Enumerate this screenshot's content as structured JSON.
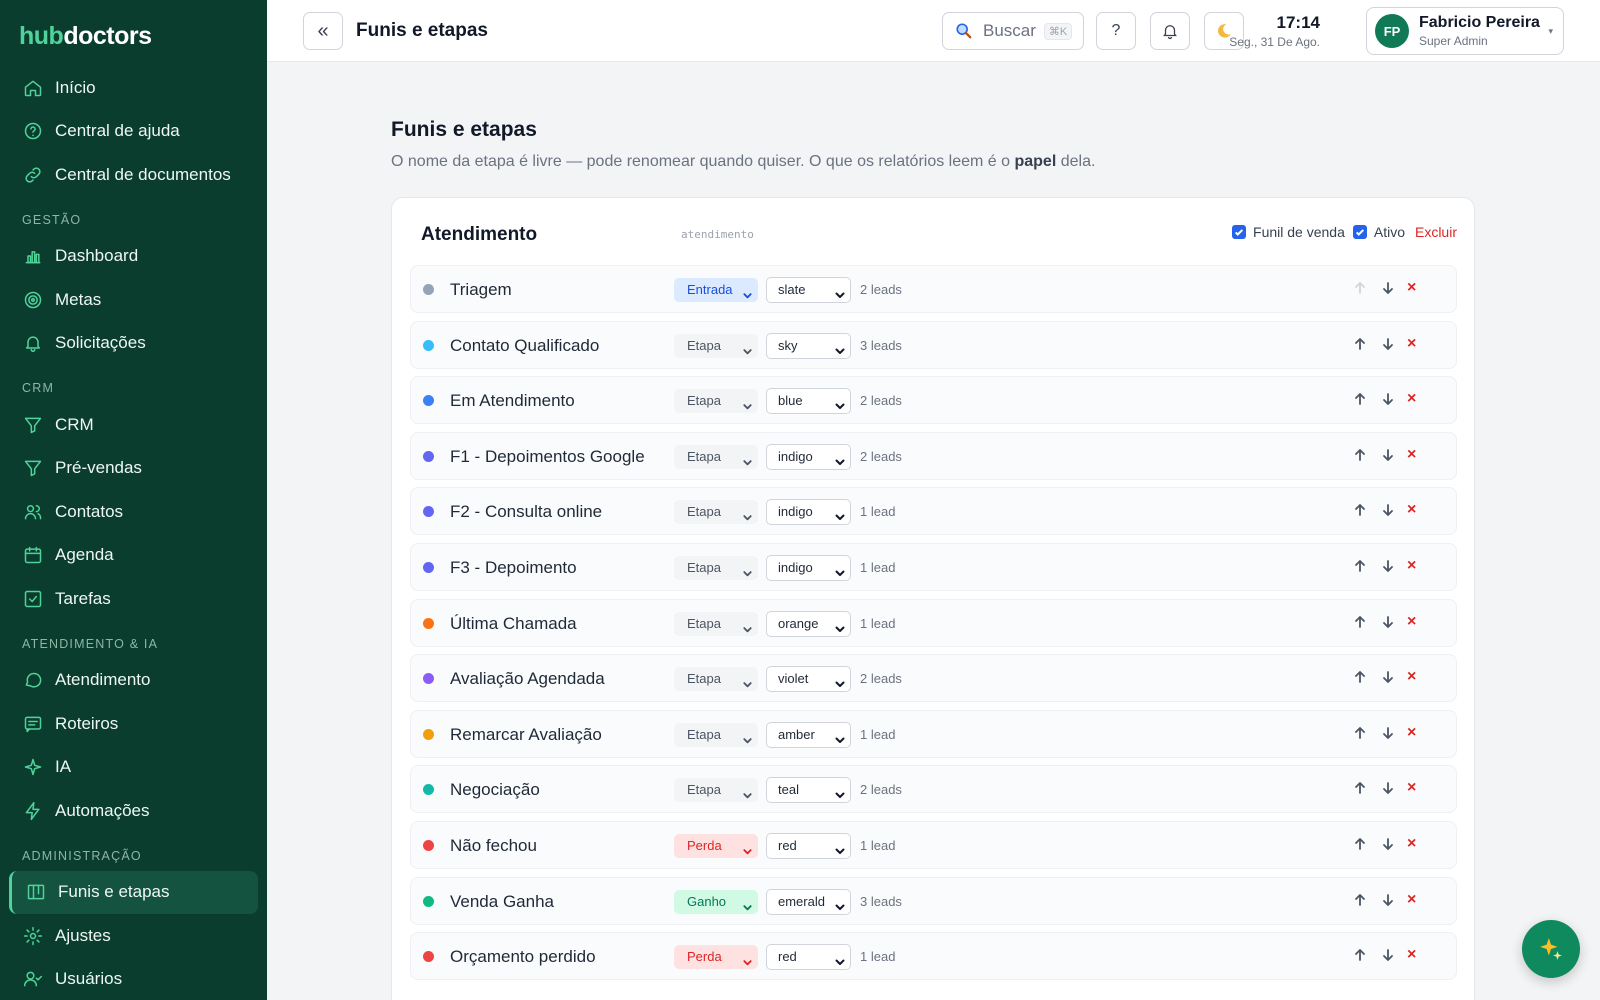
{
  "brand": {
    "part1": "hub",
    "part2": "doctors"
  },
  "sidebar": {
    "top_items": [
      {
        "label": "Início",
        "icon": "home-icon"
      },
      {
        "label": "Central de ajuda",
        "icon": "help-circle-icon"
      },
      {
        "label": "Central de documentos",
        "icon": "link-icon"
      }
    ],
    "sections": [
      {
        "title": "GESTÃO",
        "items": [
          {
            "label": "Dashboard",
            "icon": "bar-chart-icon"
          },
          {
            "label": "Metas",
            "icon": "target-icon"
          },
          {
            "label": "Solicitações",
            "icon": "bell-icon"
          }
        ]
      },
      {
        "title": "CRM",
        "items": [
          {
            "label": "CRM",
            "icon": "filter-icon"
          },
          {
            "label": "Pré-vendas",
            "icon": "filter-icon"
          },
          {
            "label": "Contatos",
            "icon": "users-icon"
          },
          {
            "label": "Agenda",
            "icon": "calendar-icon"
          },
          {
            "label": "Tarefas",
            "icon": "checkbox-icon"
          }
        ]
      },
      {
        "title": "ATENDIMENTO & IA",
        "items": [
          {
            "label": "Atendimento",
            "icon": "chat-icon"
          },
          {
            "label": "Roteiros",
            "icon": "message-square-icon"
          },
          {
            "label": "IA",
            "icon": "sparkle-icon"
          },
          {
            "label": "Automações",
            "icon": "bolt-icon"
          }
        ]
      },
      {
        "title": "ADMINISTRAÇÃO",
        "items": [
          {
            "label": "Funis e etapas",
            "icon": "kanban-icon",
            "active": true
          },
          {
            "label": "Ajustes",
            "icon": "gear-icon"
          },
          {
            "label": "Usuários",
            "icon": "user-check-icon"
          }
        ]
      }
    ]
  },
  "topbar": {
    "collapse_label": "«",
    "title": "Funis e etapas",
    "search_label": "Buscar",
    "search_shortcut": "⌘K",
    "help_label": "?",
    "time": "17:14",
    "date": "Seg., 31 De Ago.",
    "user_initials": "FP",
    "user_name": "Fabricio Pereira",
    "user_role": "Super Admin"
  },
  "main": {
    "title": "Funis e etapas",
    "subtitle_pre": "O nome da etapa é livre — pode renomear quando quiser. O que os relatórios leem é o ",
    "subtitle_bold": "papel",
    "subtitle_post": " dela."
  },
  "funnel": {
    "name": "Atendimento",
    "slug": "atendimento",
    "sales_funnel_label": "Funil de venda",
    "active_label": "Ativo",
    "delete_label": "Excluir",
    "stages": [
      {
        "name": "Triagem",
        "role": "Entrada",
        "color": "slate",
        "leads": "2 leads",
        "dot": "#94a3b8"
      },
      {
        "name": "Contato Qualificado",
        "role": "Etapa",
        "color": "sky",
        "leads": "3 leads",
        "dot": "#38bdf8"
      },
      {
        "name": "Em Atendimento",
        "role": "Etapa",
        "color": "blue",
        "leads": "2 leads",
        "dot": "#3b82f6"
      },
      {
        "name": "F1 - Depoimentos Google",
        "role": "Etapa",
        "color": "indigo",
        "leads": "2 leads",
        "dot": "#6366f1"
      },
      {
        "name": "F2 - Consulta online",
        "role": "Etapa",
        "color": "indigo",
        "leads": "1 lead",
        "dot": "#6366f1"
      },
      {
        "name": "F3 - Depoimento",
        "role": "Etapa",
        "color": "indigo",
        "leads": "1 lead",
        "dot": "#6366f1"
      },
      {
        "name": "Última Chamada",
        "role": "Etapa",
        "color": "orange",
        "leads": "1 lead",
        "dot": "#f97316"
      },
      {
        "name": "Avaliação Agendada",
        "role": "Etapa",
        "color": "violet",
        "leads": "2 leads",
        "dot": "#8b5cf6"
      },
      {
        "name": "Remarcar Avaliação",
        "role": "Etapa",
        "color": "amber",
        "leads": "1 lead",
        "dot": "#f59e0b"
      },
      {
        "name": "Negociação",
        "role": "Etapa",
        "color": "teal",
        "leads": "2 leads",
        "dot": "#14b8a6"
      },
      {
        "name": "Não fechou",
        "role": "Perda",
        "color": "red",
        "leads": "1 lead",
        "dot": "#ef4444"
      },
      {
        "name": "Venda Ganha",
        "role": "Ganho",
        "color": "emerald",
        "leads": "3 leads",
        "dot": "#10b981"
      },
      {
        "name": "Orçamento perdido",
        "role": "Perda",
        "color": "red",
        "leads": "1 lead",
        "dot": "#ef4444"
      }
    ]
  },
  "role_colors": {
    "Entrada": {
      "bg": "#dbeafe",
      "fg": "#1d4ed8"
    },
    "Etapa": {
      "bg": "#f3f4f6",
      "fg": "#4b5563"
    },
    "Perda": {
      "bg": "#fee2e2",
      "fg": "#dc2626"
    },
    "Ganho": {
      "bg": "#d1fae5",
      "fg": "#047857"
    }
  },
  "accent": "#0f8a5f"
}
